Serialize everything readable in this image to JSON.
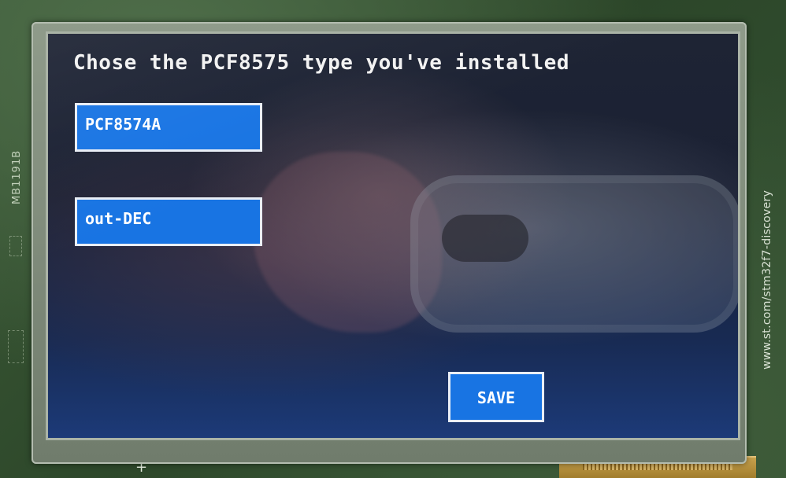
{
  "pcb": {
    "left_label": "MB1191B",
    "right_label": "www.st.com/stm32f7-discovery"
  },
  "screen": {
    "title": "Chose the PCF8575 type you've installed",
    "buttons": {
      "type_label": "PCF8574A",
      "output_label": "out-DEC",
      "save_label": "SAVE"
    }
  },
  "colors": {
    "button_fill": "#1874e3",
    "button_border": "#e9eef6",
    "text": "#f2f2f2"
  }
}
